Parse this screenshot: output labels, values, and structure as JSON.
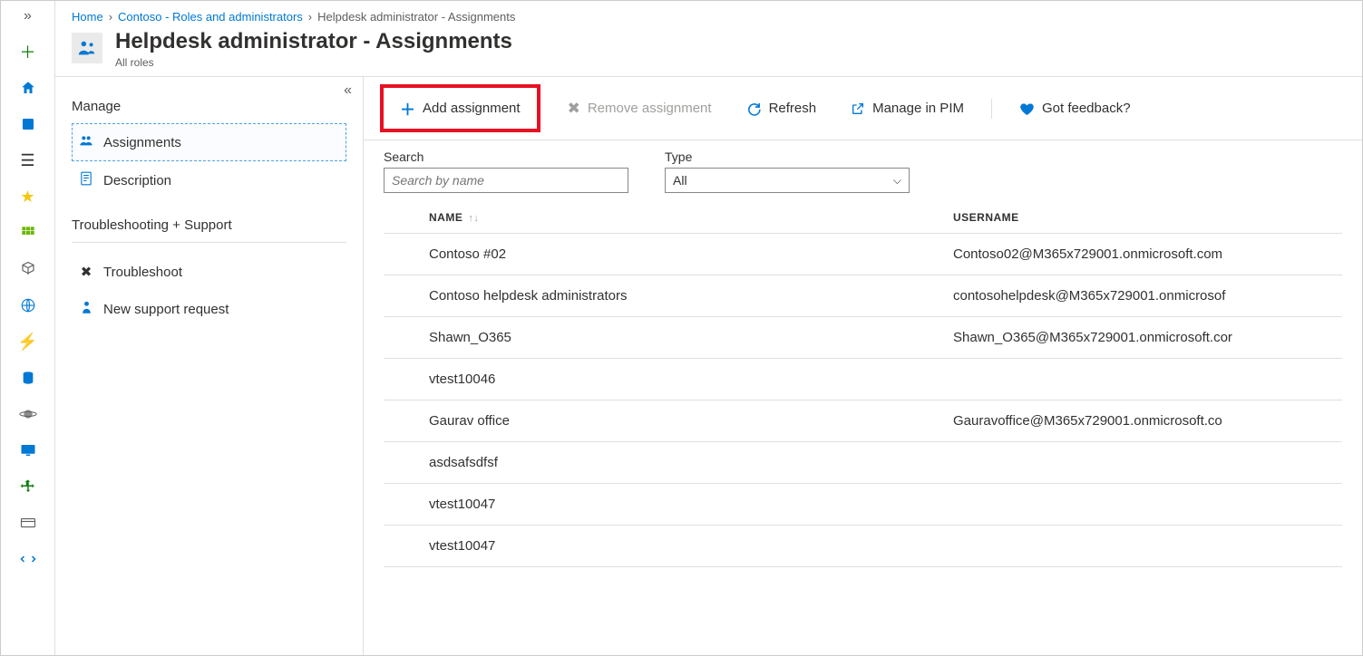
{
  "breadcrumb": {
    "home": "Home",
    "roles": "Contoso - Roles and administrators",
    "current": "Helpdesk administrator - Assignments"
  },
  "header": {
    "title": "Helpdesk administrator - Assignments",
    "subtitle": "All roles"
  },
  "leftPane": {
    "manageHeader": "Manage",
    "assignments": "Assignments",
    "description": "Description",
    "troubleshootHeader": "Troubleshooting + Support",
    "troubleshoot": "Troubleshoot",
    "newSupport": "New support request"
  },
  "toolbar": {
    "add": "Add assignment",
    "remove": "Remove assignment",
    "refresh": "Refresh",
    "managePim": "Manage in PIM",
    "feedback": "Got feedback?"
  },
  "filters": {
    "searchLabel": "Search",
    "searchPlaceholder": "Search by name",
    "typeLabel": "Type",
    "typeValue": "All"
  },
  "columns": {
    "name": "NAME",
    "username": "USERNAME"
  },
  "rows": [
    {
      "name": "Contoso #02",
      "username": "Contoso02@M365x729001.onmicrosoft.com"
    },
    {
      "name": "Contoso helpdesk administrators",
      "username": "contosohelpdesk@M365x729001.onmicrosof"
    },
    {
      "name": "Shawn_O365",
      "username": "Shawn_O365@M365x729001.onmicrosoft.cor"
    },
    {
      "name": "vtest10046",
      "username": ""
    },
    {
      "name": "Gaurav office",
      "username": "Gauravoffice@M365x729001.onmicrosoft.co"
    },
    {
      "name": "asdsafsdfsf",
      "username": ""
    },
    {
      "name": "vtest10047",
      "username": ""
    },
    {
      "name": "vtest10047",
      "username": ""
    }
  ]
}
